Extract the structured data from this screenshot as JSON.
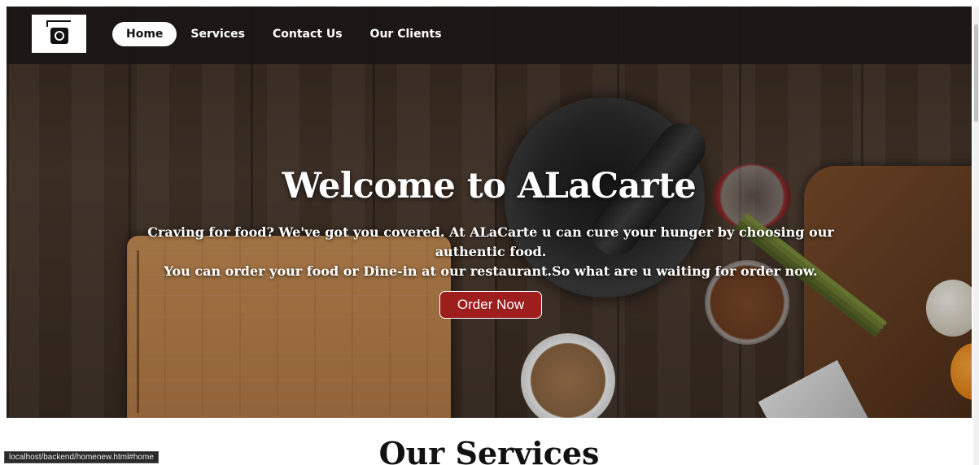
{
  "nav": {
    "logo_icon": "restaurant-sign-icon",
    "items": [
      {
        "label": "Home",
        "active": true
      },
      {
        "label": "Services",
        "active": false
      },
      {
        "label": "Contact Us",
        "active": false
      },
      {
        "label": "Our Clients",
        "active": false
      }
    ]
  },
  "hero": {
    "title": "Welcome to ALaCarte",
    "subtitle_line1": "Craving for food? We've got you covered. At ALaCarte u can cure your hunger by choosing our authentic food.",
    "subtitle_line2": "You can order your food or Dine-in at our restaurant.So what are u waiting for order now.",
    "cta_label": "Order Now"
  },
  "services": {
    "title": "Our Services"
  },
  "status_bar": {
    "url": "localhost/backend/homenew.html#home"
  },
  "colors": {
    "cta_background": "#9e1d1d",
    "nav_background": "#181614",
    "text_light": "#ffffff"
  }
}
